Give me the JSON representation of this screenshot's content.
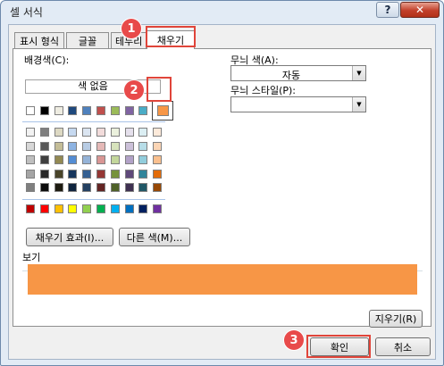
{
  "window": {
    "title": "셀 서식",
    "help_label": "?",
    "close_label": "✕"
  },
  "tabs": [
    {
      "label": "표시 형식",
      "active": false
    },
    {
      "label": "글꼴",
      "active": false
    },
    {
      "label": "테두리",
      "active": false
    },
    {
      "label": "채우기",
      "active": true
    }
  ],
  "fill": {
    "background_label": "배경색(C):",
    "no_color_label": "색 없음",
    "theme_top_row": [
      "#ffffff",
      "#000000",
      "#eeece1",
      "#1f497d",
      "#4f81bd",
      "#c0504d",
      "#9bbb59",
      "#8064a2",
      "#4bacc6",
      "#f79646"
    ],
    "theme_shades": [
      [
        "#f2f2f2",
        "#7f7f7f",
        "#ddd9c3",
        "#c6d9f0",
        "#dbe5f1",
        "#f2dcdb",
        "#ebf1dd",
        "#e5e0ec",
        "#dbeef3",
        "#fdeada"
      ],
      [
        "#d8d8d8",
        "#595959",
        "#c4bd97",
        "#8db3e2",
        "#b8cce4",
        "#e5b9b7",
        "#d7e3bc",
        "#ccc1d9",
        "#b7dde8",
        "#fbd5b5"
      ],
      [
        "#bfbfbf",
        "#3f3f3f",
        "#938953",
        "#548dd4",
        "#95b3d7",
        "#d99694",
        "#c3d69b",
        "#b2a2c7",
        "#92cddc",
        "#fac08f"
      ],
      [
        "#a5a5a5",
        "#262626",
        "#494429",
        "#17365d",
        "#366092",
        "#953734",
        "#76923c",
        "#5f497a",
        "#31859b",
        "#e36c09"
      ],
      [
        "#7f7f7f",
        "#0c0c0c",
        "#1d1b10",
        "#0f243e",
        "#244061",
        "#632423",
        "#4f6128",
        "#3f3151",
        "#205867",
        "#974806"
      ]
    ],
    "standard_colors": [
      "#c00000",
      "#ff0000",
      "#ffc000",
      "#ffff00",
      "#92d050",
      "#00b050",
      "#00b0f0",
      "#0070c0",
      "#002060",
      "#7030a0"
    ],
    "selected_color": "#f79646",
    "fill_effects_label": "채우기 효과(I)...",
    "more_colors_label": "다른 색(M)...",
    "pattern_color_label": "무늬 색(A):",
    "pattern_color_value": "자동",
    "pattern_style_label": "무늬 스타일(P):",
    "pattern_style_value": "",
    "sample_label": "보기",
    "clear_label": "지우기(R)"
  },
  "footer": {
    "ok_label": "확인",
    "cancel_label": "취소"
  },
  "callouts": [
    "1",
    "2",
    "3"
  ],
  "colors": {
    "highlight": "#e0453a",
    "callout_bg": "#e84a4a"
  }
}
